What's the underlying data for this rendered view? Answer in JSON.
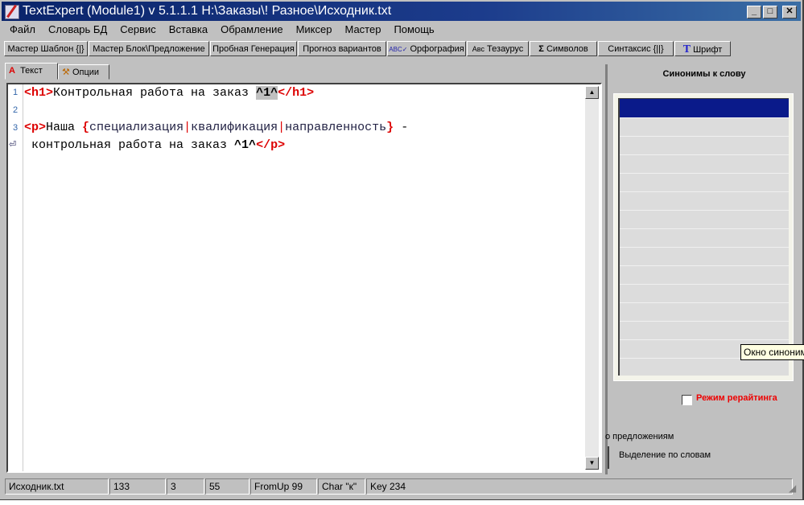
{
  "window": {
    "title": "TextExpert (Module1) v 5.1.1.1    H:\\Заказы\\! Разное\\Исходник.txt",
    "minimize": "_",
    "maximize": "□",
    "close": "✕"
  },
  "menu": [
    "Файл",
    "Словарь БД",
    "Сервис",
    "Вставка",
    "Обрамление",
    "Миксер",
    "Мастер",
    "Помощь"
  ],
  "toolbar": [
    "Мастер Шаблон {|}",
    "Мастер Блок\\Предложение",
    "Пробная Генерация",
    "Прогноз вариантов",
    "Орфография",
    "Тезаурус",
    "Символов",
    "Синтаксис {||}",
    "Шрифт"
  ],
  "toolbar_icons": {
    "spell": "ABC✓",
    "thesaurus": "Aʙc",
    "symbols": "Σ",
    "font": "T"
  },
  "tabs": [
    "Текст",
    "Опции"
  ],
  "editor": {
    "line_numbers": [
      "1",
      "2",
      "3"
    ],
    "line1": {
      "open": "<h1>",
      "text": "Контрольная работа на заказ ",
      "var": "^1^",
      "close": "</h1>"
    },
    "line3": {
      "open": "<p>",
      "text": "Наша ",
      "brace_open": "{",
      "alt1": "специализация",
      "pipe": "|",
      "alt2": "квалификация",
      "alt3": "направленность",
      "brace_close": "}",
      "dash": " -"
    },
    "line4": {
      "text": " контрольная работа на заказ ",
      "var": "^1^",
      "close": "</p>"
    }
  },
  "right_panel": {
    "title": "Синонимы к слову",
    "tooltip": "Окно синонимов",
    "rewrite_mode": "Режим рерайтинга",
    "by_sentences": "о предложениям",
    "by_words": "Выделение по словам"
  },
  "status": [
    "Исходник.txt",
    "133",
    "3",
    "55",
    "FromUp  99",
    "Char \"к\"",
    "Key  234"
  ]
}
